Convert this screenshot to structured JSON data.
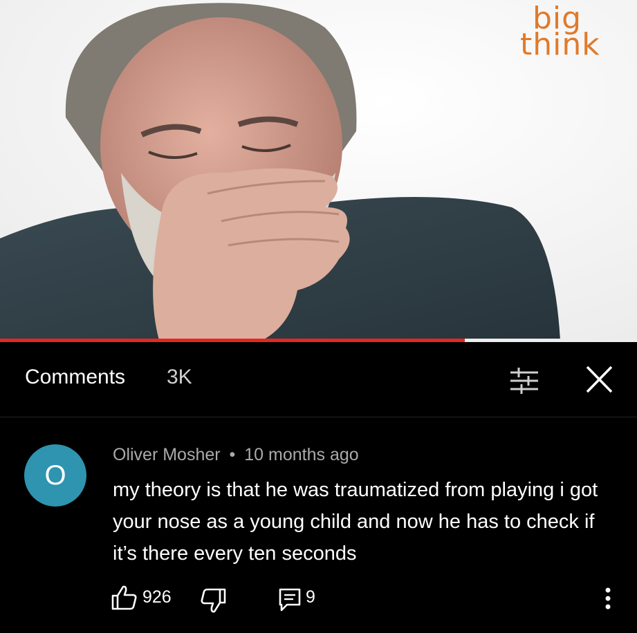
{
  "video": {
    "watermark_line1": "big",
    "watermark_line2": "think",
    "progress_fraction": 0.73,
    "colors": {
      "progress": "#e7271f",
      "watermark": "#e07a2a"
    }
  },
  "comments_header": {
    "title": "Comments",
    "count": "3K",
    "filter_icon": "sort-filter-icon",
    "close_icon": "close-icon"
  },
  "comment": {
    "avatar_letter": "O",
    "avatar_color": "#2e94b0",
    "author": "Oliver Mosher",
    "separator": "•",
    "time": "10 months ago",
    "text": "my theory is that he was traumatized from playing i got your nose as a young child and now he has to check if it’s there every ten seconds",
    "likes": "926",
    "replies": "9",
    "icons": [
      "thumbs-up-icon",
      "thumbs-down-icon",
      "reply-icon",
      "more-vert-icon"
    ]
  }
}
